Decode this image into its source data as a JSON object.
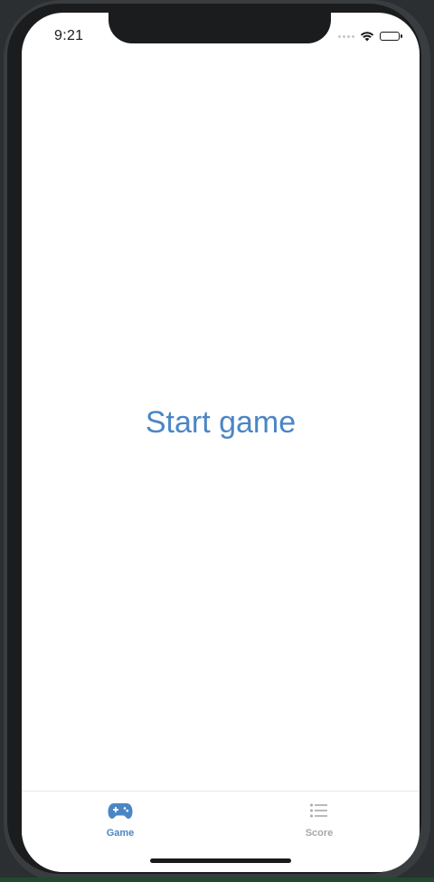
{
  "status_bar": {
    "time": "9:21"
  },
  "main": {
    "start_button_label": "Start game"
  },
  "tab_bar": {
    "items": [
      {
        "label": "Game",
        "icon": "gamepad-icon",
        "active": true
      },
      {
        "label": "Score",
        "icon": "list-icon",
        "active": false
      }
    ]
  },
  "colors": {
    "accent": "#4a86c5",
    "inactive": "#a8a8a8",
    "background": "#ffffff"
  }
}
